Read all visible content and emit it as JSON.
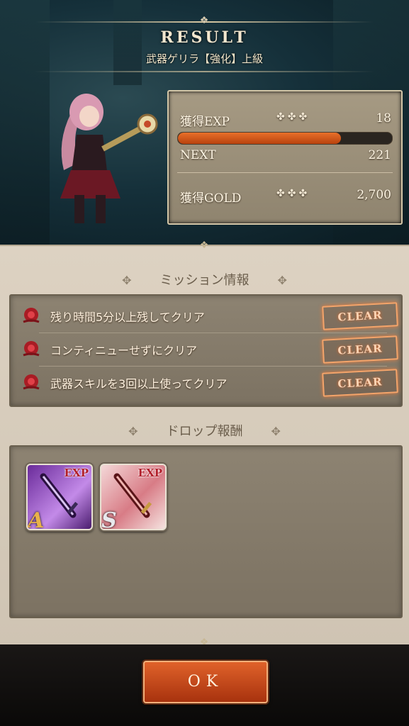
{
  "header": {
    "title": "RESULT",
    "subtitle": "武器ゲリラ【強化】上級"
  },
  "stats": {
    "exp_label": "獲得EXP",
    "exp_value": "18",
    "exp_ornament": "✤✤✤",
    "exp_progress": 0.76,
    "next_label": "NEXT",
    "next_value": "221",
    "gold_label": "獲得GOLD",
    "gold_value": "2,700",
    "gold_ornament": "✤✤✤"
  },
  "missions": {
    "heading": "ミッション情報",
    "items": [
      {
        "text": "残り時間5分以上残してクリア",
        "status": "CLEAR"
      },
      {
        "text": "コンティニューせずにクリア",
        "status": "CLEAR"
      },
      {
        "text": "武器スキルを3回以上使ってクリア",
        "status": "CLEAR"
      }
    ]
  },
  "drops": {
    "heading": "ドロップ報酬",
    "items": [
      {
        "tag": "EXP",
        "rank": "A",
        "icon": "purple-sword-icon"
      },
      {
        "tag": "EXP",
        "rank": "S",
        "icon": "red-sword-icon"
      }
    ]
  },
  "ok_button": "OK",
  "colors": {
    "accent": "#c9471a",
    "panel": "#d6cbbb",
    "clear_stamp": "#f4a46a"
  }
}
